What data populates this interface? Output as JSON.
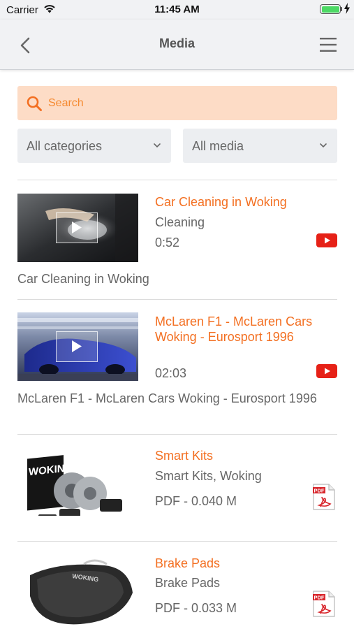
{
  "status_bar": {
    "carrier": "Carrier",
    "time": "11:45 AM",
    "battery_level": 1.0
  },
  "nav": {
    "title": "Media",
    "back_icon": "chevron-left-icon",
    "menu_icon": "hamburger-menu-icon"
  },
  "search": {
    "placeholder": "Search",
    "value": ""
  },
  "filters": {
    "category": "All categories",
    "media": "All media"
  },
  "colors": {
    "accent": "#f36f21",
    "search_bg": "#fddcc6",
    "filter_bg": "#eceef1",
    "youtube_red": "#e62117",
    "pdf_red": "#d8262c"
  },
  "items": [
    {
      "title": "Car Cleaning in Woking",
      "subtitle": "Cleaning",
      "meta": "0:52",
      "type": "video",
      "badge_icon": "youtube-icon",
      "description": "Car Cleaning in Woking"
    },
    {
      "title": "McLaren F1 - McLaren Cars Woking - Eurosport 1996",
      "subtitle": "",
      "meta": "02:03",
      "type": "video",
      "badge_icon": "youtube-icon",
      "description": "McLaren F1 - McLaren Cars Woking - Eurosport 1996"
    },
    {
      "title": "Smart Kits",
      "subtitle": "Smart Kits, Woking",
      "meta": "PDF - 0.040 M",
      "type": "pdf",
      "badge_icon": "pdf-icon",
      "thumb_brand": "WOKING"
    },
    {
      "title": "Brake Pads",
      "subtitle": "Brake Pads",
      "meta": "PDF - 0.033 M",
      "type": "pdf",
      "badge_icon": "pdf-icon",
      "thumb_brand": "WOKING"
    }
  ]
}
